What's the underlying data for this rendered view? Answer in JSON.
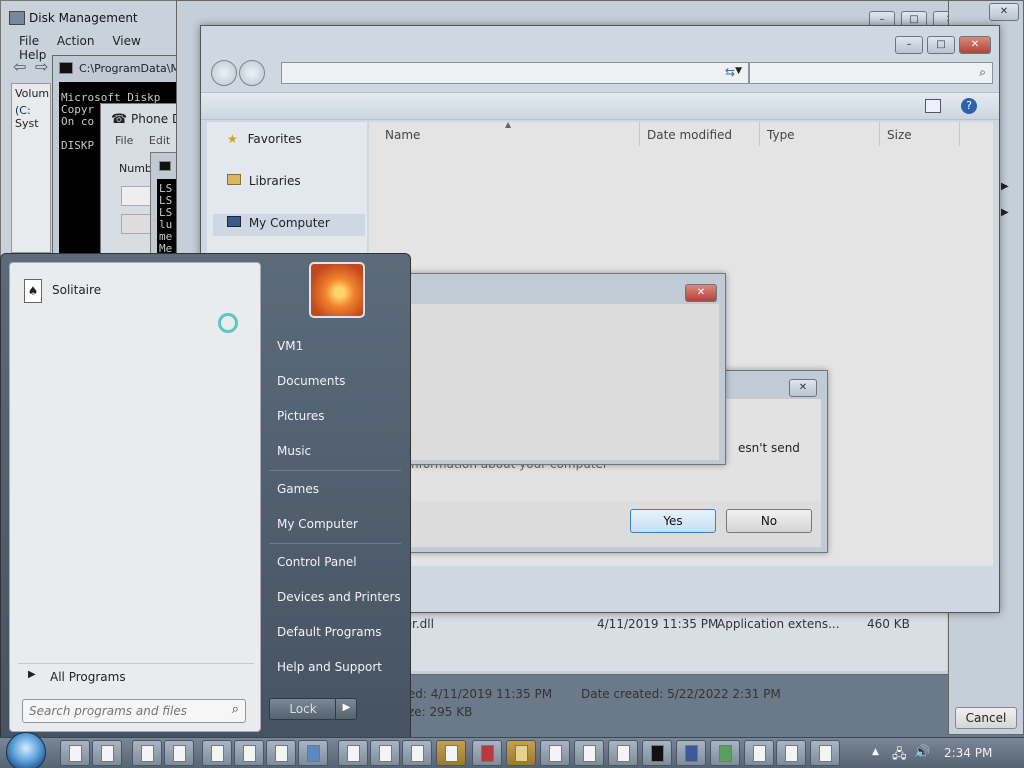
{
  "disk_management": {
    "title": "Disk Management",
    "menu": [
      "File",
      "Action",
      "View",
      "Help"
    ],
    "volumes_header": "Volum",
    "volumes": [
      "(C:",
      "Syst"
    ]
  },
  "cmd_window": {
    "title": "C:\\ProgramData\\M",
    "lines": "Microsoft Diskp\nCopyr\nOn co\n\nDISKP"
  },
  "phone_dialer": {
    "title": "Phone D",
    "menu": [
      "File",
      "Edit"
    ],
    "number_label": "Numbe"
  },
  "console2": {
    "lines": "LS\nLS\nLS\nlu\nme\nMe"
  },
  "main_explorer": {
    "nav_items": [
      {
        "label": "Favorites",
        "icon": "star-icon"
      },
      {
        "label": "Libraries",
        "icon": "libraries-icon"
      },
      {
        "label": "My Computer",
        "icon": "computer-icon"
      }
    ],
    "columns": [
      "Name",
      "Date modified",
      "Type",
      "Size"
    ]
  },
  "bg_explorer": {
    "file_row": {
      "name": "der.dll",
      "date": "4/11/2019 11:35 PM",
      "type": "Application extens...",
      "size": "460 KB"
    },
    "details": {
      "modified": "ified: 4/11/2019 11:35 PM",
      "created": "Date created:  5/22/2022 2:31 PM",
      "size": "Size: 295 KB"
    }
  },
  "right_window": {
    "cancel_label": "Cancel"
  },
  "dialog_back": {
    "msg1": "esn't send",
    "msg2": "nformation about your computer",
    "yes_label": "Yes",
    "no_label": "No"
  },
  "start_menu": {
    "pinned": [
      {
        "label": "Solitaire",
        "icon": "solitaire-icon"
      }
    ],
    "all_programs": "All Programs",
    "search_placeholder": "Search programs and files",
    "right_items": [
      "VM1",
      "Documents",
      "Pictures",
      "Music",
      "Games",
      "My Computer",
      "Control Panel",
      "Devices and Printers",
      "Default Programs",
      "Help and Support"
    ],
    "lock_label": "Lock"
  },
  "taskbar": {
    "clock": "2:34 PM"
  }
}
